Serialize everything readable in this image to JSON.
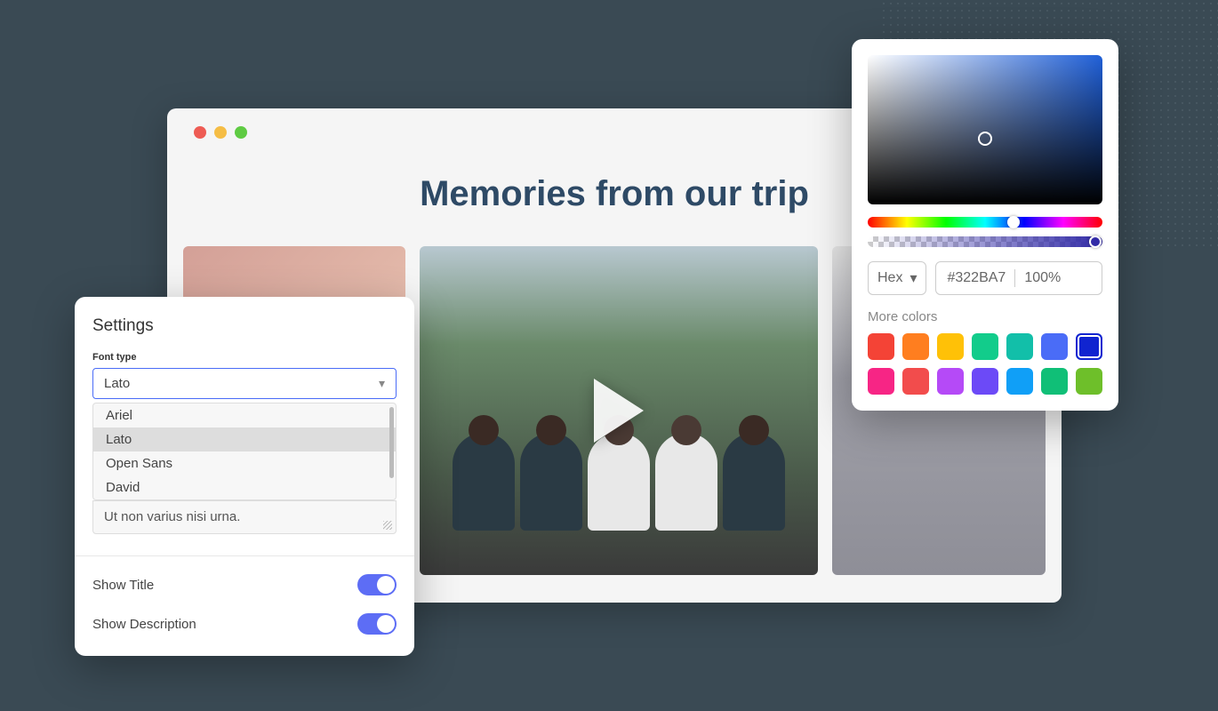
{
  "browser": {
    "page_title": "Memories from our trip"
  },
  "settings": {
    "title": "Settings",
    "font_type_label": "Font type",
    "font_type_selected": "Lato",
    "font_options": [
      "Ariel",
      "Lato",
      "Open Sans",
      "David"
    ],
    "textarea_value": "Ut non varius nisi urna.",
    "toggles": [
      {
        "label": "Show Title",
        "on": true
      },
      {
        "label": "Show Description",
        "on": true
      }
    ]
  },
  "color_picker": {
    "format": "Hex",
    "hex_value": "#322BA7",
    "alpha": "100%",
    "more_colors_label": "More colors",
    "swatches_row1": [
      "#F44336",
      "#FF7E1F",
      "#FFC107",
      "#12CC8B",
      "#12BFA9",
      "#4A6CF7",
      "#1024D0"
    ],
    "swatches_row2": [
      "#F72585",
      "#F24C4C",
      "#B54AF7",
      "#6C4AF7",
      "#109FF7",
      "#10BF77",
      "#6EBF2A"
    ],
    "selected_swatch": "#1024D0"
  }
}
